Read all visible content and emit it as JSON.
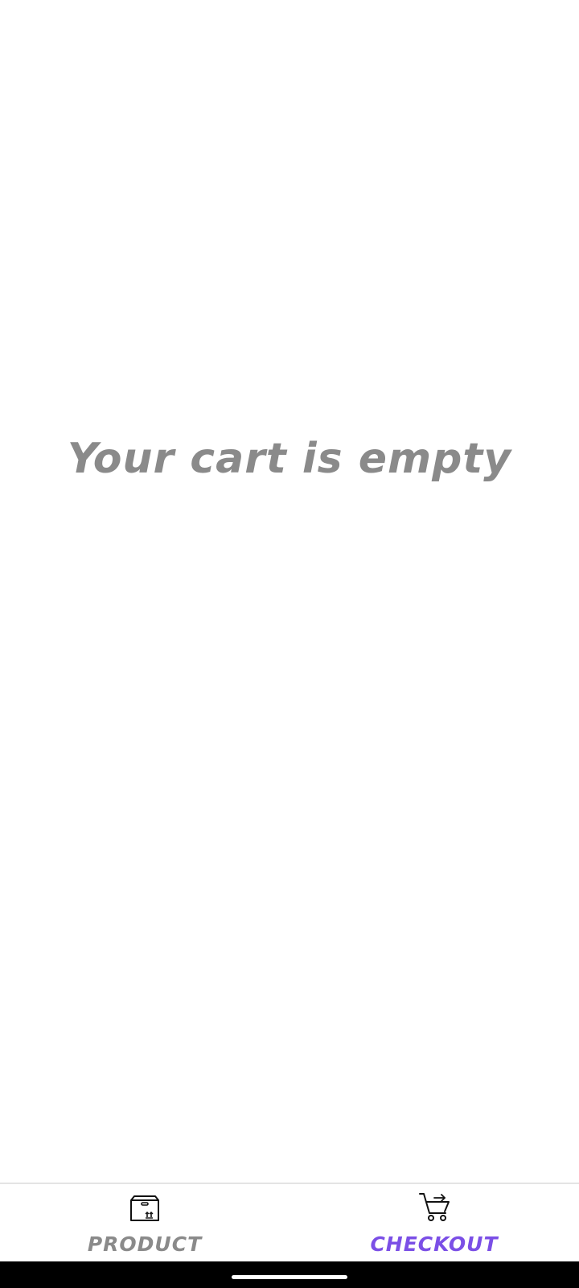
{
  "cart": {
    "empty_message": "Your cart is empty"
  },
  "bottom_nav": {
    "items": [
      {
        "label": "PRODUCT",
        "icon": "box-icon",
        "active": false
      },
      {
        "label": "CHECKOUT",
        "icon": "cart-icon",
        "active": true
      }
    ]
  },
  "colors": {
    "background": "#ffffff",
    "inactive": "#8a8a8a",
    "accent": "#7b4fe6",
    "system_bar": "#000000"
  }
}
